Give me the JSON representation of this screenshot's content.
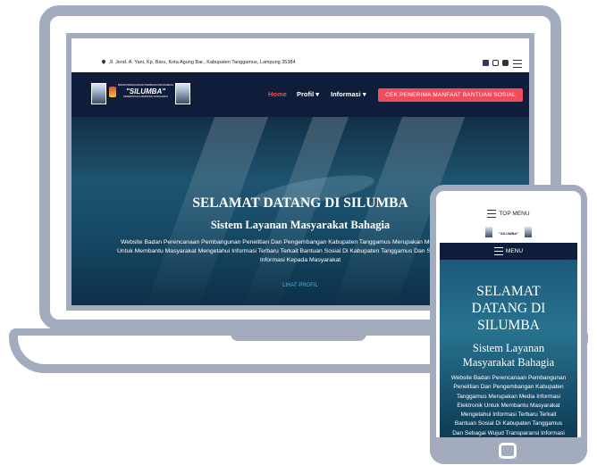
{
  "desktop": {
    "topbar": {
      "address": "Jl. Jend. A. Yani, Kp. Baru, Kota Agung Bar., Kabupaten Tanggamus, Lampung 35384"
    },
    "logo": {
      "small_top": "BADAN PERENCANAAN PEMBANGUNAN DAERAH",
      "name": "\"SILUMBA\"",
      "small_bottom": "PEMERINTAH KABUPATEN TANGGAMUS"
    },
    "nav": {
      "home": "Home",
      "profil": "Profil ▾",
      "informasi": "Informasi ▾",
      "cta": "CEK PENERIMA MANFAAT BANTUAN SOSIAL"
    },
    "hero": {
      "title": "SELAMAT DATANG DI SILUMBA",
      "subtitle": "Sistem Layanan Masyarakat Bahagia",
      "desc_line1": "Website Badan Perencanaan Pembangunan Penelitian Dan Pengembangan Kabupaten Tanggamus Merupakan Media Int",
      "desc_line2": "Untuk Membantu Masyarakat Mengetahui Informasi Terbaru Terkait Bantuan Sosial Di Kabupaten Tanggamus Dan Sebaga",
      "desc_line3": "Informasi Kepada Masyarakat",
      "link": "LIHAT PROFIL"
    }
  },
  "mobile": {
    "top_menu": "TOP MENU",
    "logo_name": "\"SILUMBA\"",
    "menu": "MENU",
    "hero": {
      "title_line1": "SELAMAT",
      "title_line2": "DATANG DI",
      "title_line3": "SILUMBA",
      "sub_line1": "Sistem Layanan",
      "sub_line2": "Masyarakat Bahagia",
      "desc_lines": [
        "Website Badan Perencanaan Pembangunan",
        "Penelitian Dan Pengembangan Kabupaten",
        "Tanggamus Merupakan Media Informasi",
        "Elektronik Untuk Membantu Masyarakat",
        "Mengetahui Informasi Terbaru Terkait",
        "Bantuan Sosial Di Kabupaten Tanggamus",
        "Dan Sebagai Wujud Transparansi Informasi"
      ]
    }
  },
  "colors": {
    "device_frame": "#a3abbe",
    "navbar": "#0f1c3a",
    "accent": "#ef4d5c",
    "home_active": "#ef4d5c"
  },
  "icons": [
    "map-pin-icon",
    "facebook-icon",
    "instagram-icon",
    "youtube-icon",
    "menu-icon"
  ]
}
